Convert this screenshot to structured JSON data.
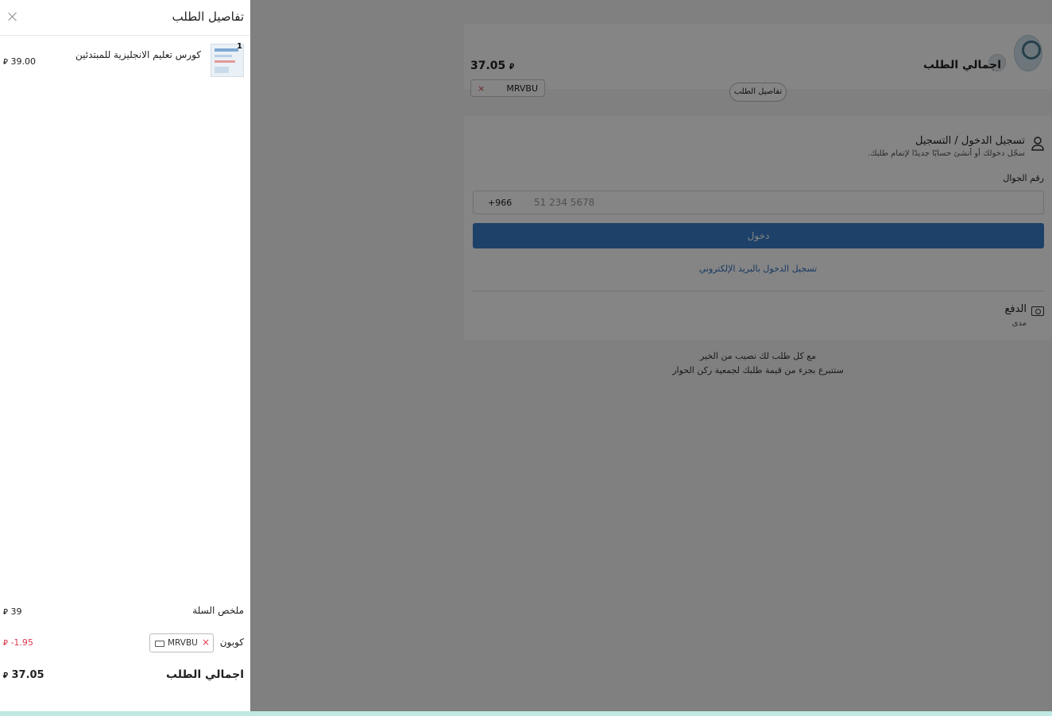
{
  "background": {
    "summary": {
      "total_label": "اجمالي الطلب",
      "total_amount": "37.05",
      "coupon_code": "MRVBU",
      "coupon_remove": "×",
      "details_button": "تفاصيل الطلب"
    },
    "login": {
      "title": "تسجيل الدخول / التسجيل",
      "subtitle": "سجّل دخولك أو أنشئ حسابًا جديدًا لإتمام طلبك.",
      "phone_label": "رقم الجوال",
      "country_code": "+966",
      "phone_placeholder": "51 234 5678",
      "login_button": "دخول",
      "email_link": "تسجيل الدخول بالبريد الإلكتروني"
    },
    "payment": {
      "title": "الدفع",
      "subtitle": "مدى"
    },
    "charity": {
      "line1": "مع كل طلب لك نصيب من الخير",
      "line2": "ستتبرع بجزء من قيمة طلبك لجمعية ركن الحوار"
    }
  },
  "drawer": {
    "title": "تفاصيل الطلب",
    "items": [
      {
        "quantity": "1",
        "name": "كورس تعليم الانجليزية للمبتدئين",
        "price": "39.00"
      }
    ],
    "cart_summary_label": "ملخص السلة",
    "cart_summary_value": "39",
    "coupon_label": "كوبون",
    "coupon_code": "MRVBU",
    "coupon_remove": "×",
    "discount_value": "-1.95",
    "order_total_label": "اجمالي الطلب",
    "order_total_value": "37.05",
    "currency_symbol": "⃁"
  },
  "colors": {
    "accent": "#3a7dc9",
    "discount": "#d93b4e",
    "overlay": "#7a7a7a"
  }
}
